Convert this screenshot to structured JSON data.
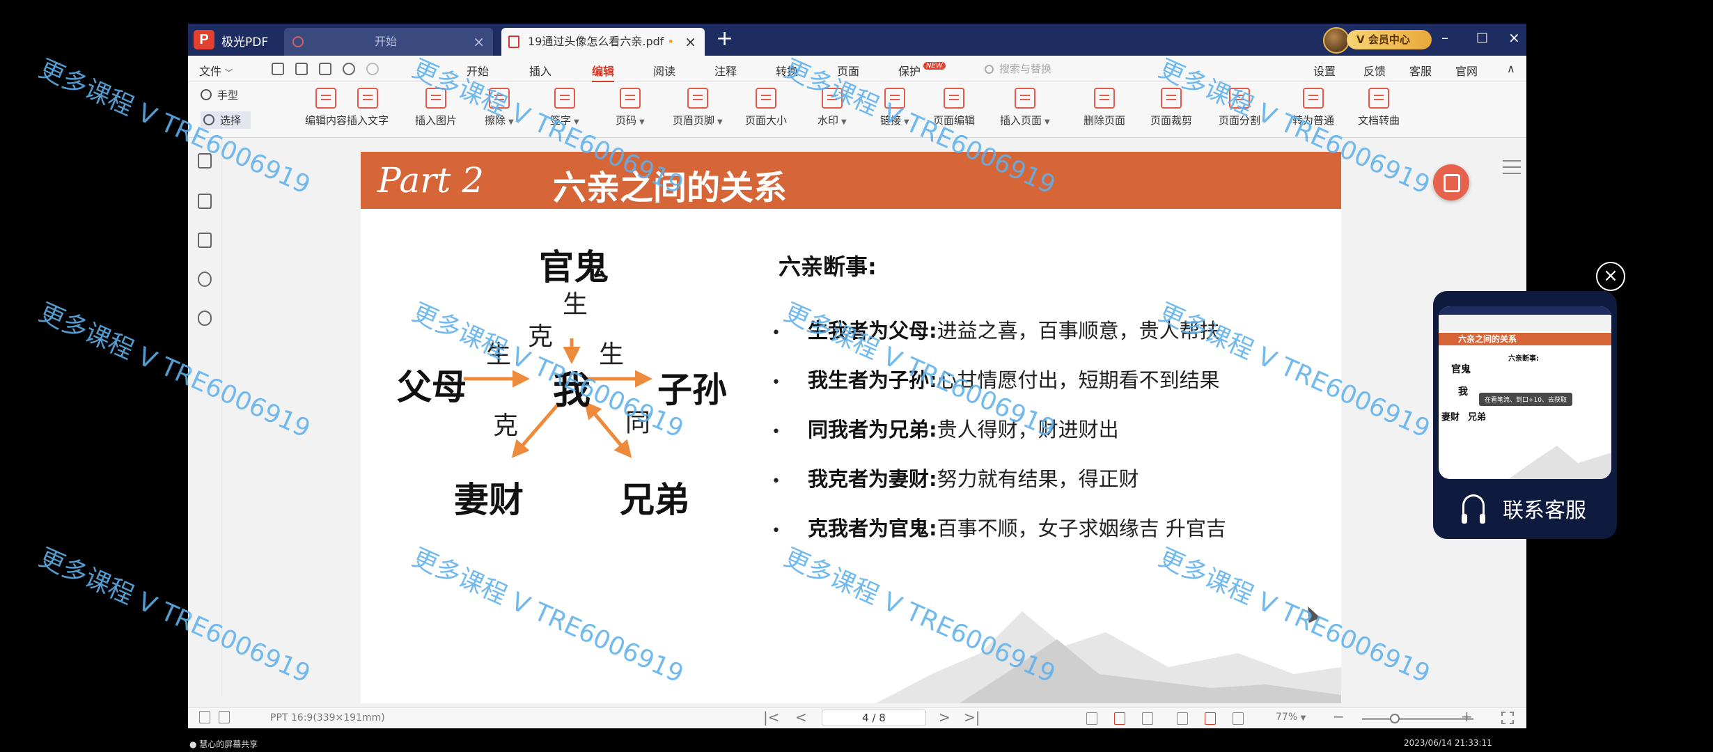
{
  "titlebar": {
    "app_name": "极光PDF",
    "tabs": [
      {
        "label": "开始",
        "close": "×"
      },
      {
        "label": "19通过头像怎么看六亲.pdf",
        "modified": "•",
        "close": "×"
      }
    ],
    "new_tab": "+",
    "vip_label": "V 会员中心",
    "window_controls": [
      "–",
      "□",
      "×"
    ]
  },
  "menubar": {
    "file": "文件",
    "items": [
      "开始",
      "插入",
      "编辑",
      "阅读",
      "注释",
      "转换",
      "页面",
      "保护"
    ],
    "active": "编辑",
    "new_badge": "NEW",
    "search_placeholder": "搜索与替换",
    "right_items": [
      "设置",
      "反馈",
      "客服",
      "官网"
    ],
    "collapse": "∧"
  },
  "toolbar": {
    "mode_hand": "手型",
    "mode_select": "选择",
    "tools": [
      {
        "label": "编辑内容",
        "caret": false
      },
      {
        "label": "插入文字",
        "caret": false
      },
      {
        "label": "插入图片",
        "caret": false
      },
      {
        "label": "擦除",
        "caret": true
      },
      {
        "label": "签字",
        "caret": true
      },
      {
        "label": "页码",
        "caret": true
      },
      {
        "label": "页眉页脚",
        "caret": true
      },
      {
        "label": "页面大小",
        "caret": false
      },
      {
        "label": "水印",
        "caret": true
      },
      {
        "label": "链接",
        "caret": true
      },
      {
        "label": "页面编辑",
        "caret": false
      },
      {
        "label": "插入页面",
        "caret": true
      },
      {
        "label": "删除页面",
        "caret": false
      },
      {
        "label": "页面裁剪",
        "caret": false
      },
      {
        "label": "页面分割",
        "caret": false
      },
      {
        "label": "转为普通",
        "caret": false
      },
      {
        "label": "文档转曲",
        "caret": false
      }
    ]
  },
  "slide": {
    "part": "Part 2",
    "title": "六亲之间的关系",
    "diagram": {
      "top": "官鬼",
      "left": "父母",
      "center": "我",
      "right": "子孙",
      "bottom_left": "妻财",
      "bottom_right": "兄弟",
      "rel_top_sheng": "生",
      "rel_top_ke": "克",
      "rel_left_sheng": "生",
      "rel_right_sheng": "生",
      "rel_bl_ke": "克",
      "rel_br_tong": "同"
    },
    "right_heading": "六亲断事:",
    "rules": [
      {
        "bullet": "•",
        "term": "生我者为父母:",
        "desc": "进益之喜，百事顺意，贵人帮扶"
      },
      {
        "bullet": "•",
        "term": "我生者为子孙:",
        "desc": "心甘情愿付出，短期看不到结果"
      },
      {
        "bullet": "•",
        "term": "同我者为兄弟:",
        "desc": "贵人得财，财进财出"
      },
      {
        "bullet": "•",
        "term": "我克者为妻财:",
        "desc": "努力就有结果，得正财"
      },
      {
        "bullet": "•",
        "term": "克我者为官鬼:",
        "desc": "百事不顺，女子求姻缘吉  升官吉"
      }
    ]
  },
  "statusbar": {
    "page_size": "PPT 16:9(339×191mm)",
    "page_indicator": "4 / 8",
    "nav": [
      "|<",
      "<",
      ">",
      ">|"
    ],
    "zoom": "77%",
    "zoom_minus": "−",
    "zoom_plus": "+"
  },
  "watermark": "更多课程 V TRE6006919",
  "cs_widget": {
    "label": "联系客服",
    "close": "×",
    "preview_title": "六亲之间的关系",
    "preview_heading": "六亲断事:",
    "preview_toast": "在看笔流、到口+10、去获取"
  },
  "taskbar": {
    "left": "慧心的屏幕共享",
    "right": "2023/06/14 21:33:11"
  },
  "colors": {
    "titlebar": "#1d2d62",
    "accent": "#d23c2a",
    "slide_header": "#d66538",
    "arrow": "#ee8a3c",
    "watermark": "#5eb0ea",
    "widget": "#0e1b3e"
  }
}
